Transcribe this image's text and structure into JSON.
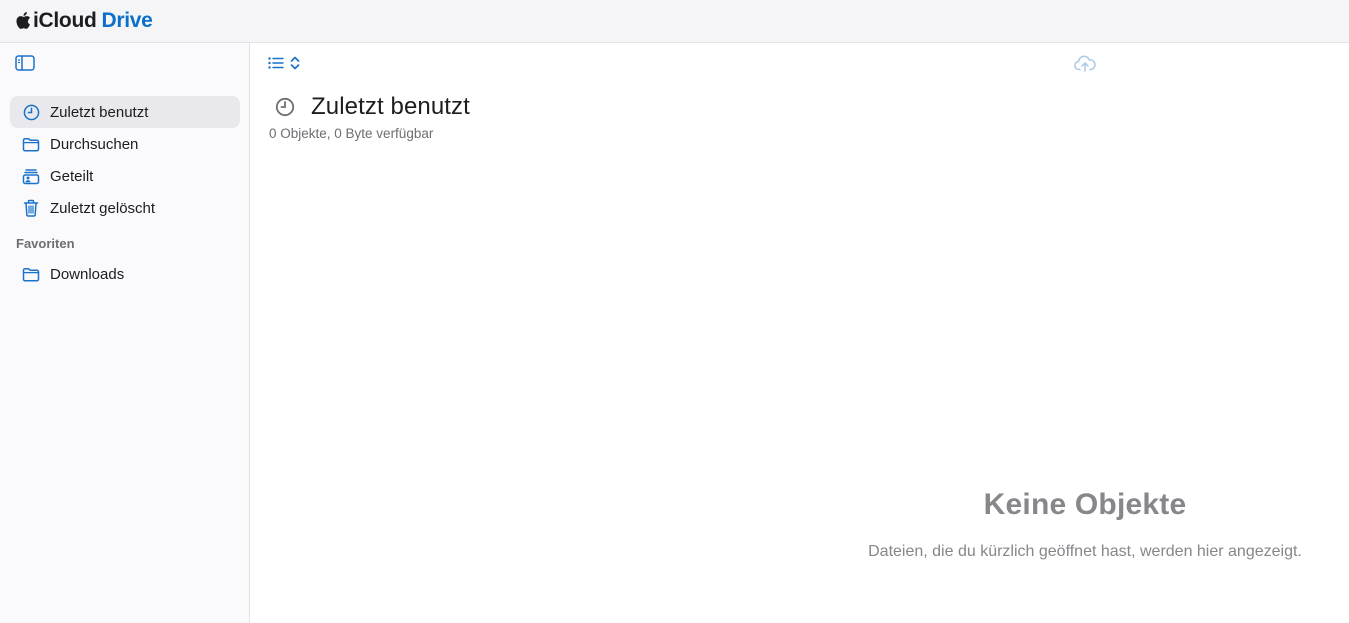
{
  "header": {
    "brand": "iCloud",
    "product": "Drive"
  },
  "colors": {
    "accent": "#0a70c9",
    "icon_blue": "#1a73c8",
    "muted": "#86868b",
    "active_bg": "#e8e8ed"
  },
  "sidebar": {
    "toggle_icon": "sidebar-toggle-icon",
    "items": [
      {
        "label": "Zuletzt benutzt",
        "icon": "clock-icon",
        "active": true
      },
      {
        "label": "Durchsuchen",
        "icon": "folder-icon",
        "active": false
      },
      {
        "label": "Geteilt",
        "icon": "shared-folder-icon",
        "active": false
      },
      {
        "label": "Zuletzt gelöscht",
        "icon": "trash-icon",
        "active": false
      }
    ],
    "favorites_title": "Favoriten",
    "favorites": [
      {
        "label": "Downloads",
        "icon": "folder-icon"
      }
    ]
  },
  "main": {
    "title": "Zuletzt benutzt",
    "subtitle": "0 Objekte, 0 Byte verfügbar",
    "empty_title": "Keine Objekte",
    "empty_description": "Dateien, die du kürzlich geöffnet hast, werden hier angezeigt."
  }
}
